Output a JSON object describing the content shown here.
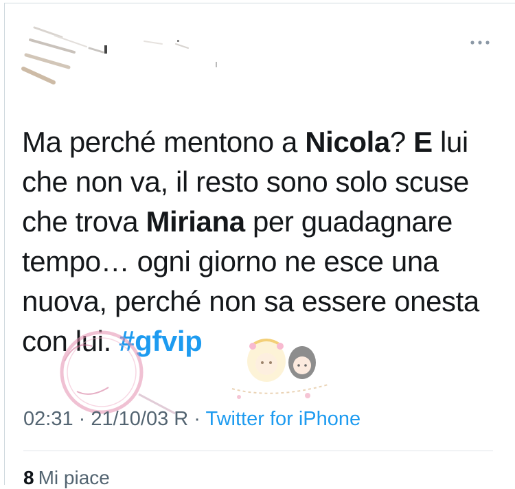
{
  "tweet": {
    "text_segments": [
      {
        "text": "Ma perché mentono a ",
        "bold": false
      },
      {
        "text": "Nicola",
        "bold": true
      },
      {
        "text": "? ",
        "bold": false
      },
      {
        "text": "E",
        "bold": true
      },
      {
        "text": " lui che non va, il resto sono solo scuse che trova ",
        "bold": false
      },
      {
        "text": "Miriana",
        "bold": true
      },
      {
        "text": " per guadagnare tempo… ogni giorno ne esce una nuova, perché non sa essere onesta con lui. ",
        "bold": false
      }
    ],
    "hashtag": "#gfvip",
    "timestamp": "02:31 · 21/10/03 R · ",
    "source": "Twitter for iPhone",
    "likes_count": "8",
    "likes_label": "Mi piace"
  },
  "icons": {
    "more": "more-horizontal-icon"
  },
  "colors": {
    "link": "#1d9bf0",
    "text": "#14171a",
    "meta": "#536471",
    "divider": "#dfe4e8"
  }
}
